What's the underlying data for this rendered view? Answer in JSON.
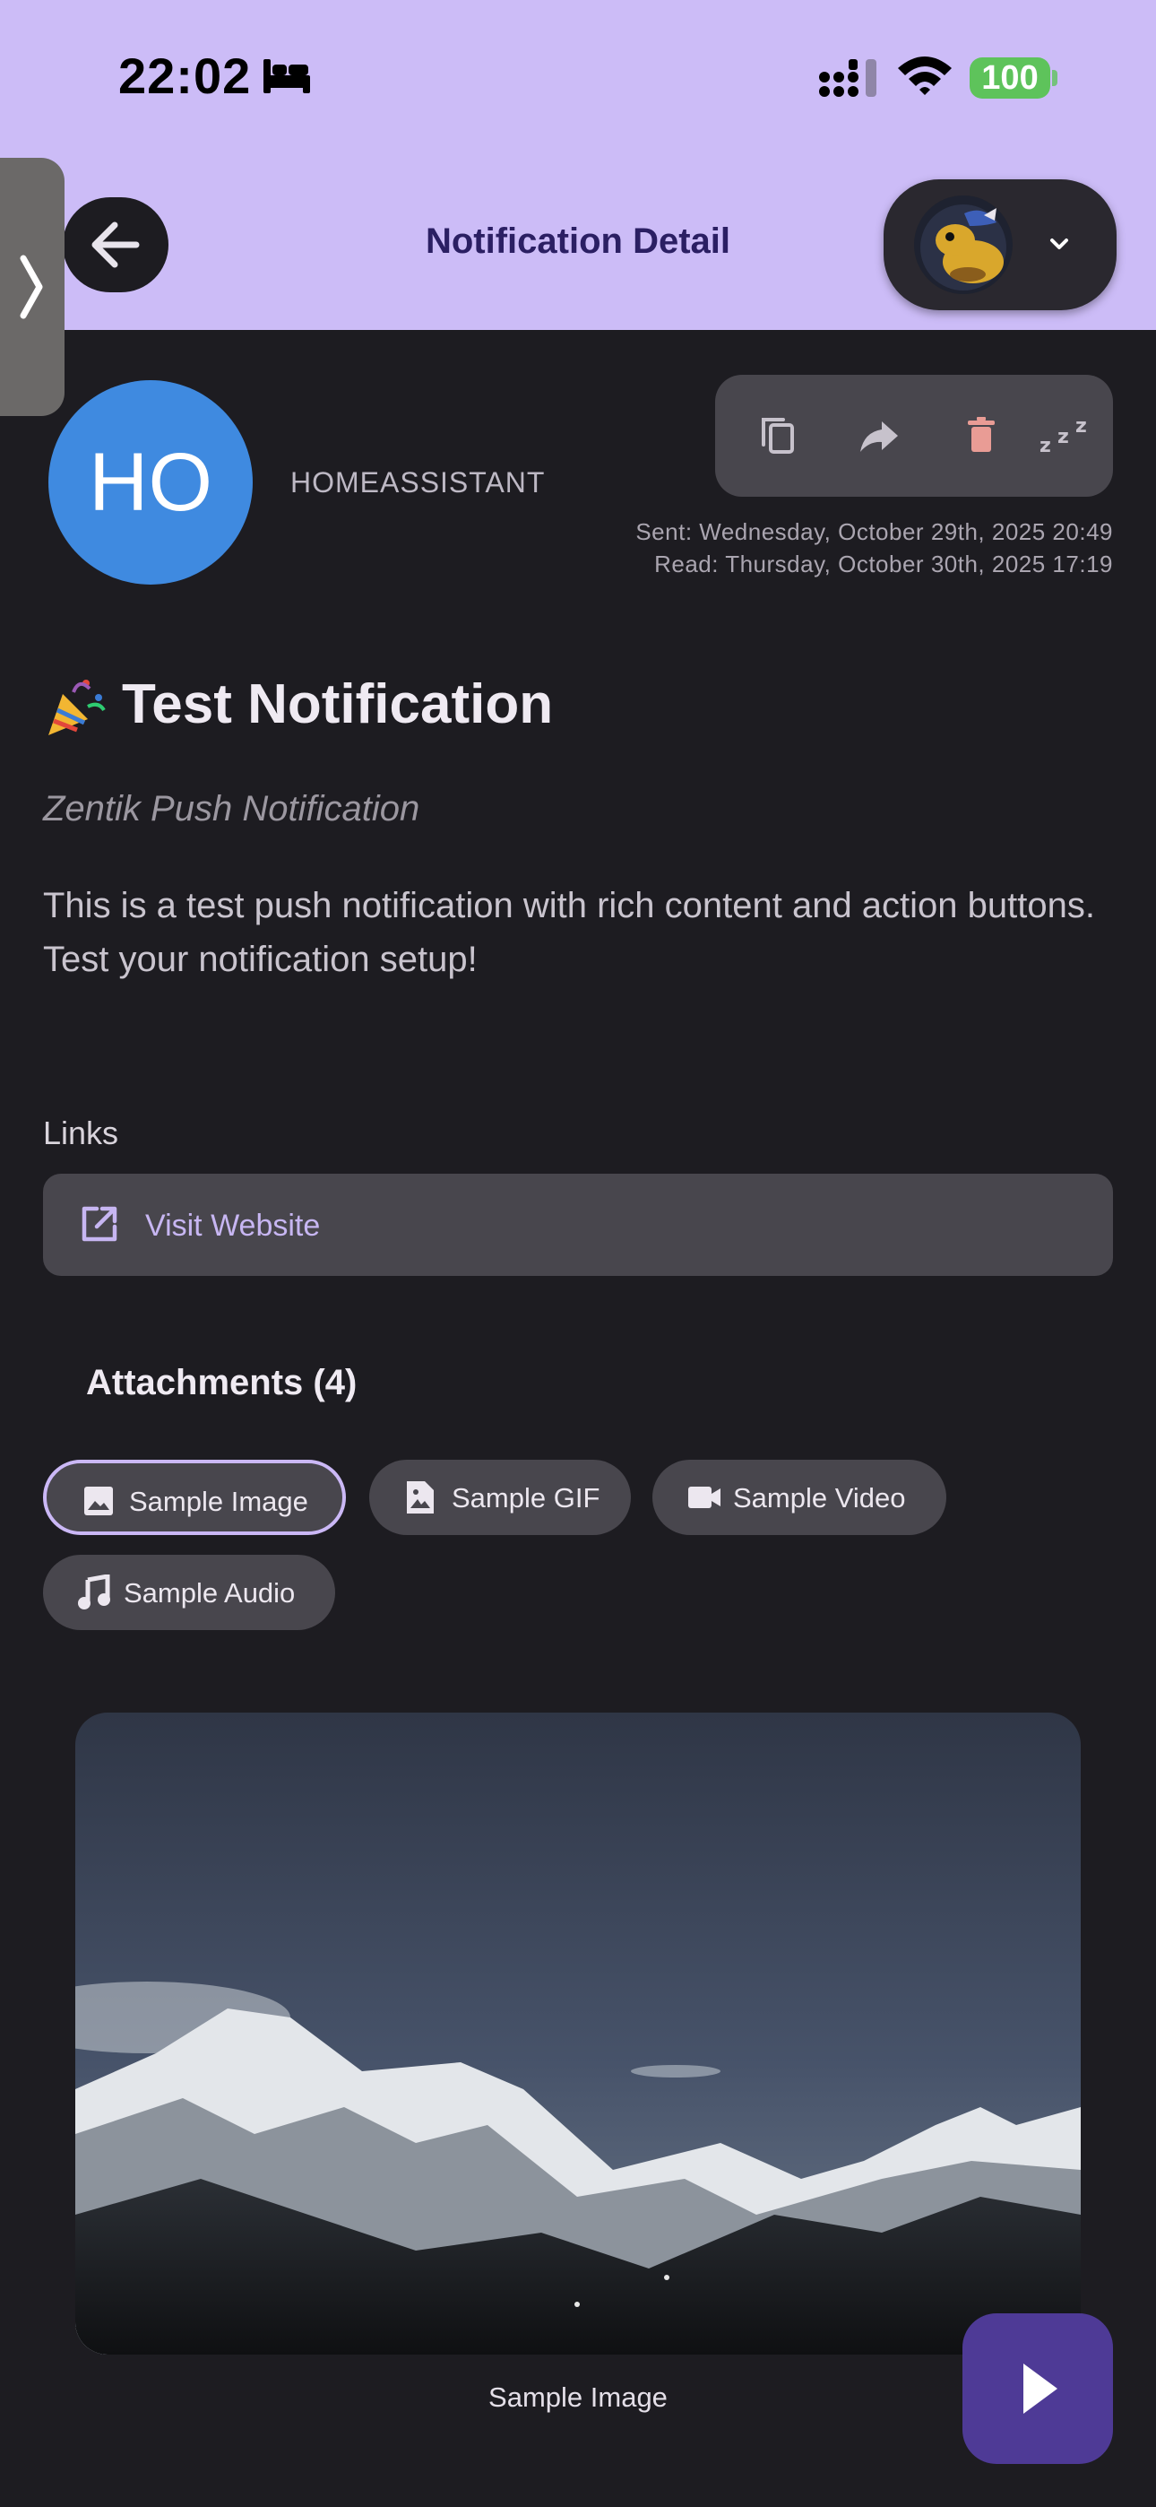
{
  "status_bar": {
    "time": "22:02",
    "battery": "100"
  },
  "header": {
    "title": "Notification Detail"
  },
  "sender": {
    "initials": "HO",
    "name": "HOMEASSISTANT"
  },
  "meta": {
    "sent": "Sent: Wednesday, October 29th, 2025 20:49",
    "read": "Read: Thursday, October 30th, 2025 17:19"
  },
  "notification": {
    "title": "Test Notification",
    "subtitle": "Zentik Push Notification",
    "body": "This is a test push notification with rich content and action buttons. Test your notification setup!"
  },
  "links": {
    "heading": "Links",
    "items": [
      {
        "label": "Visit Website"
      }
    ]
  },
  "attachments": {
    "heading": "Attachments (4)",
    "items": [
      {
        "label": "Sample Image",
        "icon": "image-icon"
      },
      {
        "label": "Sample GIF",
        "icon": "gif-file-icon"
      },
      {
        "label": "Sample Video",
        "icon": "videocam-icon"
      },
      {
        "label": "Sample Audio",
        "icon": "music-note-icon"
      }
    ],
    "selected": "Sample Image",
    "caption": "Sample Image"
  },
  "colors": {
    "header_bg": "#ccbcf7",
    "page_bg": "#1d1c21",
    "avatar": "#3f8ae0",
    "accent": "#cbb8f6",
    "fab": "#4e3a96",
    "battery": "#5ec35b"
  }
}
